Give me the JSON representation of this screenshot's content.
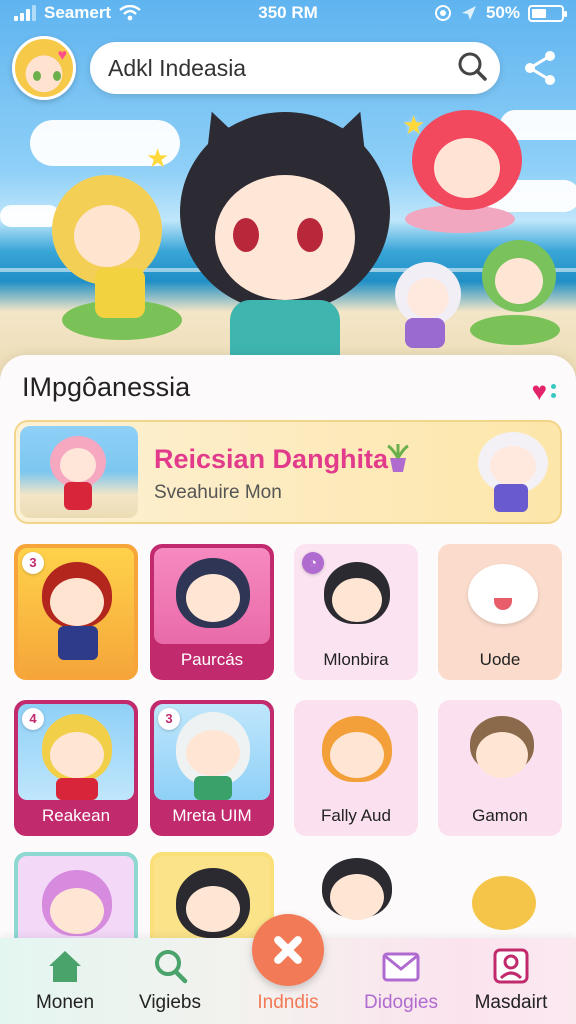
{
  "status_bar": {
    "carrier": "Seamert",
    "time": "350 RM",
    "battery": "50%"
  },
  "header": {
    "search_value": "Adkl Indeasia"
  },
  "section": {
    "title": "IMpgôanessia"
  },
  "featured": {
    "title": "Reicsian Danghita",
    "subtitle": "Sveahuire Mon"
  },
  "grid": {
    "items": [
      {
        "label": "",
        "badge": "3"
      },
      {
        "label": "Paurcás",
        "badge": ""
      },
      {
        "label": "Mlonbira",
        "badge": ""
      },
      {
        "label": "Uode",
        "badge": ""
      },
      {
        "label": "Reakean",
        "badge": "4"
      },
      {
        "label": "Mreta UIM",
        "badge": "3"
      },
      {
        "label": "Fally Aud",
        "badge": ""
      },
      {
        "label": "Gamon",
        "badge": ""
      }
    ]
  },
  "nav": {
    "items": [
      {
        "label": "Monen",
        "icon": "home-icon",
        "color": "#4aa36a"
      },
      {
        "label": "Vigiebs",
        "icon": "search-icon",
        "color": "#4aa36a"
      },
      {
        "label": "Indndis",
        "icon": "close-icon",
        "color": "#f37a56"
      },
      {
        "label": "Didogies",
        "icon": "mail-icon",
        "color": "#b06bd0"
      },
      {
        "label": "Masdairt",
        "icon": "profile-card-icon",
        "color": "#c22a6e"
      }
    ]
  },
  "colors": {
    "accent": "#e23b8c",
    "fab": "#f37a56",
    "heart": "#e3246b"
  }
}
